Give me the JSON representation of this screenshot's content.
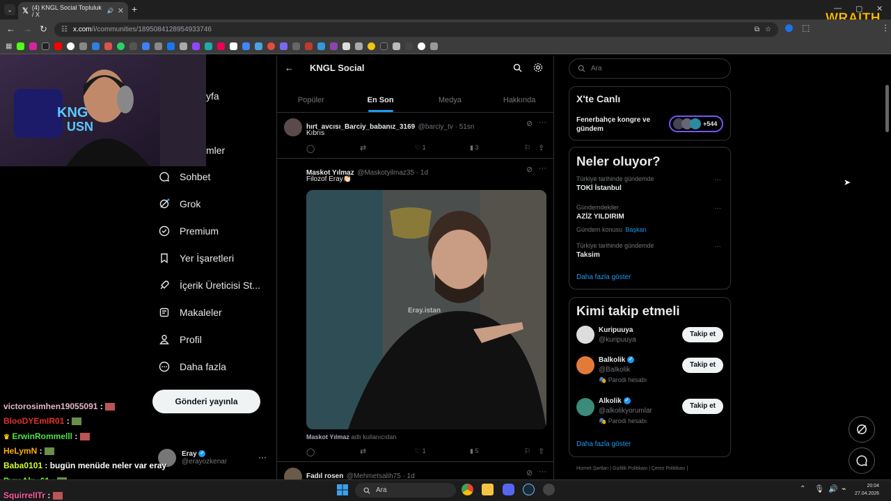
{
  "browser": {
    "tab_title": "(4) KNGL Social Topluluk / X",
    "url_prefix": "x.com",
    "url_rest": "/i/communities/1895084128954933746",
    "overlay_logo": "WRAITH"
  },
  "nav": {
    "items": [
      "Sohbet",
      "Grok",
      "Premium",
      "Yer İşaretleri",
      "İçerik Üreticisi St...",
      "Makaleler",
      "Profil",
      "Daha fazla"
    ],
    "partial_top": [
      "yfa",
      "mler"
    ],
    "post_button": "Gönderi yayınla",
    "profile_name": "Eray",
    "profile_handle": "@erayozkenar",
    "more": "···"
  },
  "community": {
    "title": "KNGL Social",
    "tabs": [
      "Popüler",
      "En Son",
      "Medya",
      "Hakkında"
    ],
    "active_tab": "En Son"
  },
  "posts": [
    {
      "name": "hırt_avcısı_Barciy_babanız_3169",
      "meta": "@barciy_tv · 51sn",
      "text": "Kıbrıs",
      "likes": "1",
      "views": "3"
    },
    {
      "name": "Maskot Yılmaz",
      "meta": "@Maskotyilmaz35 · 1d",
      "text": "Filozof Eray👏🏻",
      "watermark": "Eray.istan",
      "caption_name": "Maskot Yılmaz",
      "caption_meta": "adlı kullanıcıdan",
      "likes": "1",
      "views": "5"
    },
    {
      "name": "Fadıl rosen",
      "meta": "@Mehmetsalih75 · 1d"
    }
  ],
  "sidebar": {
    "search_placeholder": "Ara",
    "live": {
      "title": "X'te Canlı",
      "topic": "Fenerbahçe kongre ve gündem",
      "count": "+544"
    },
    "trends": {
      "title": "Neler oluyor?",
      "items": [
        {
          "context": "Türkiye tarihinde gündemde",
          "name": "TOKİ İstanbul",
          "extra_label": "",
          "extra_link": ""
        },
        {
          "context": "Gündemdekiler",
          "name": "AZİZ YILDIRIM",
          "extra_label": "Gündem konusu",
          "extra_link": "Başkan"
        },
        {
          "context": "Türkiye tarihinde gündemde",
          "name": "Taksim",
          "extra_label": "",
          "extra_link": ""
        }
      ],
      "show_more": "Daha fazla göster"
    },
    "who_to_follow": {
      "title": "Kimi takip etmeli",
      "follow_label": "Takip et",
      "users": [
        {
          "name": "Kuripuuya",
          "handle": "@kuripuuya",
          "note": ""
        },
        {
          "name": "Balkolik",
          "handle": "@BaIkolik",
          "note": "🎭 Parodi hesabı"
        },
        {
          "name": "Alkolik",
          "handle": "@alkolikyorumlar",
          "note": "🎭 Parodi hesabı"
        }
      ],
      "show_more": "Daha fazla göster"
    },
    "footer": "Hizmet Şartları  |  Gizlilik Politikası  |  Çerez Politikası  |"
  },
  "chat": [
    {
      "user": "victorosimhen19055091",
      "msg": "",
      "color": "#e4b8c8"
    },
    {
      "user": "BlooDYEmIR01",
      "msg": "",
      "color": "#e0312b"
    },
    {
      "user": "ErwinRommelll",
      "msg": "",
      "color": "#4ee04e"
    },
    {
      "user": "HeLymN",
      "msg": "",
      "color": "#ffae00"
    },
    {
      "user": "Baba0101",
      "msg": "bugün menüde neler var eray",
      "color": "#d4ff2a"
    },
    {
      "user": "PyroAlp_61",
      "msg": "",
      "color": "#6cff3a"
    },
    {
      "user": "SquirrelITr",
      "msg": "",
      "color": "#ff5fa5"
    }
  ],
  "taskbar": {
    "search": "Ara",
    "time": "20:04",
    "date": "27.04.2026"
  }
}
